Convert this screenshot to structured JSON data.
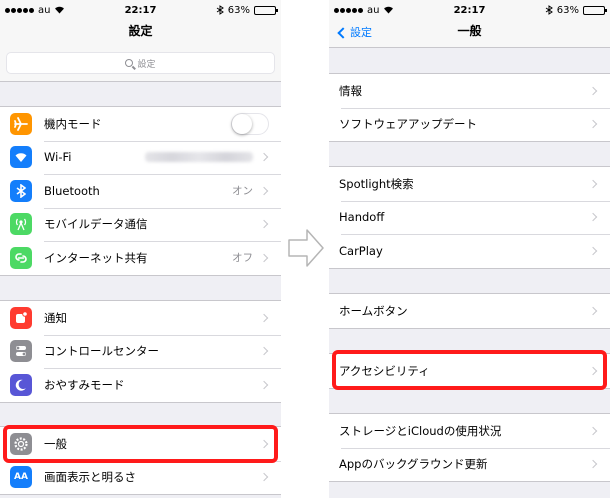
{
  "left": {
    "status": {
      "carrier": "au",
      "time": "22:17",
      "battery": "63%",
      "battery_level": 0.63
    },
    "nav_title": "設定",
    "search_placeholder": "設定",
    "group1": [
      {
        "label": "機内モード",
        "icon": "airplane-icon",
        "color": "#ff9500",
        "toggle": true,
        "toggle_on": false
      },
      {
        "label": "Wi-Fi",
        "icon": "wifi-icon",
        "color": "#147efb",
        "value_blurred": true
      },
      {
        "label": "Bluetooth",
        "icon": "bluetooth-icon",
        "color": "#147efb",
        "value": "オン"
      },
      {
        "label": "モバイルデータ通信",
        "icon": "cellular-icon",
        "color": "#4cd964"
      },
      {
        "label": "インターネット共有",
        "icon": "hotspot-icon",
        "color": "#4cd964",
        "value": "オフ"
      }
    ],
    "group2": [
      {
        "label": "通知",
        "icon": "notifications-icon",
        "color": "#ff3b30"
      },
      {
        "label": "コントロールセンター",
        "icon": "control-center-icon",
        "color": "#8e8e93"
      },
      {
        "label": "おやすみモード",
        "icon": "moon-icon",
        "color": "#5856d6"
      }
    ],
    "group3": [
      {
        "label": "一般",
        "icon": "gear-icon",
        "color": "#8e8e93"
      },
      {
        "label": "画面表示と明るさ",
        "icon": "display-icon",
        "color": "#147efb",
        "icon_text": "AA"
      }
    ]
  },
  "right": {
    "status": {
      "carrier": "au",
      "time": "22:17",
      "battery": "63%",
      "battery_level": 0.63
    },
    "back_label": "設定",
    "nav_title": "一般",
    "group1": [
      {
        "label": "情報"
      },
      {
        "label": "ソフトウェアアップデート"
      }
    ],
    "group2": [
      {
        "label": "Spotlight検索"
      },
      {
        "label": "Handoff"
      },
      {
        "label": "CarPlay"
      }
    ],
    "group3": [
      {
        "label": "ホームボタン"
      }
    ],
    "group4": [
      {
        "label": "アクセシビリティ"
      }
    ],
    "group5": [
      {
        "label": "ストレージとiCloudの使用状況"
      },
      {
        "label": "Appのバックグラウンド更新"
      }
    ]
  },
  "colors": {
    "accent": "#007aff",
    "highlight": "#ff1a1a"
  }
}
